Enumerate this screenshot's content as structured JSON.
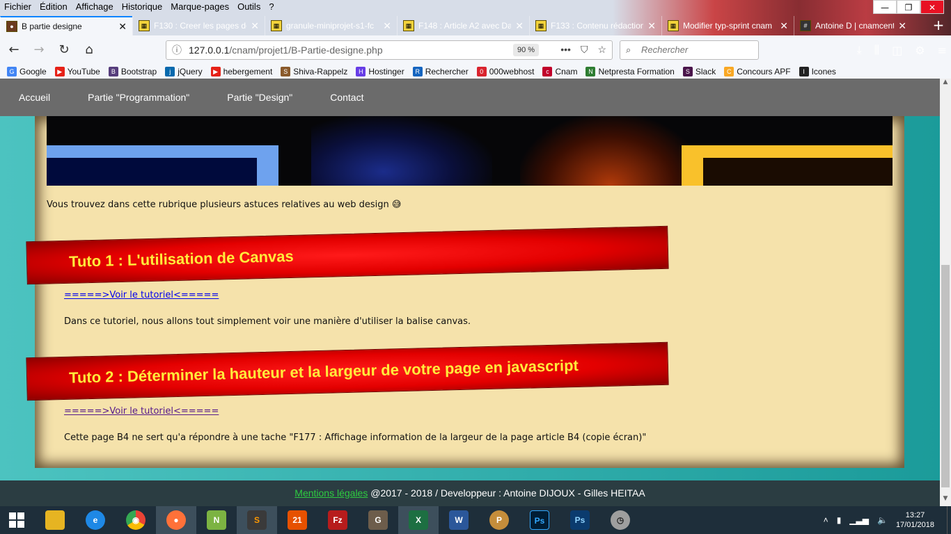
{
  "browser": {
    "menu": [
      "Fichier",
      "Édition",
      "Affichage",
      "Historique",
      "Marque-pages",
      "Outils",
      "?"
    ],
    "window_controls": {
      "minimize": "—",
      "maximize": "❐",
      "close": "✕"
    },
    "tabs": [
      {
        "title": "B partie designe",
        "active": true
      },
      {
        "title": "F130 : Creer les pages de",
        "active": false
      },
      {
        "title": "granule-miniprojet-s1-fc",
        "active": false
      },
      {
        "title": "F148 : Article A2 avec Da",
        "active": false
      },
      {
        "title": "F133 : Contenu rédaction",
        "active": false
      },
      {
        "title": "Modifier typ-sprint cnam",
        "active": false
      },
      {
        "title": "Antoine D | cnamcentre",
        "active": false
      }
    ],
    "new_tab": "+",
    "url": {
      "host": "127.0.0.1",
      "path": "/cnam/projet1/B-Partie-designe.php"
    },
    "zoom": "90 %",
    "search_placeholder": "Rechercher",
    "bookmarks": [
      {
        "label": "Google",
        "color": "#4285f4",
        "glyph": "G"
      },
      {
        "label": "YouTube",
        "color": "#e62117",
        "glyph": "▶"
      },
      {
        "label": "Bootstrap",
        "color": "#563d7c",
        "glyph": "B"
      },
      {
        "label": "jQuery",
        "color": "#0769ad",
        "glyph": "j"
      },
      {
        "label": "hebergement",
        "color": "#e62117",
        "glyph": "▶"
      },
      {
        "label": "Shiva-Rappelz",
        "color": "#8a5a2b",
        "glyph": "S"
      },
      {
        "label": "Hostinger",
        "color": "#673de6",
        "glyph": "H"
      },
      {
        "label": "Rechercher",
        "color": "#1565c0",
        "glyph": "R"
      },
      {
        "label": "000webhost",
        "color": "#d9232e",
        "glyph": "0"
      },
      {
        "label": "Cnam",
        "color": "#c1002a",
        "glyph": "c"
      },
      {
        "label": "Netpresta Formation",
        "color": "#2e7d32",
        "glyph": "N"
      },
      {
        "label": "Slack",
        "color": "#4a154b",
        "glyph": "S"
      },
      {
        "label": "Concours APF",
        "color": "#f9a825",
        "glyph": "C"
      },
      {
        "label": "Icones",
        "color": "#222222",
        "glyph": "I"
      }
    ]
  },
  "site": {
    "nav": [
      "Accueil",
      "Partie \"Programmation\"",
      "Partie \"Design\"",
      "Contact"
    ],
    "intro": "Vous trouvez dans cette rubrique plusieurs astuces relatives au web design 😅",
    "tutorials": [
      {
        "title": "Tuto 1 : L'utilisation de Canvas",
        "link": "=====>Voir le tutoriel<=====",
        "link_color": "#0000ee",
        "desc": "Dans ce tutoriel, nous allons tout simplement voir une manière d'utiliser la balise canvas."
      },
      {
        "title": "Tuto 2 : Déterminer la hauteur et la largeur de votre page en javascript",
        "link": "=====>Voir le tutoriel<=====",
        "link_color": "#551a8b",
        "desc": "Cette page B4 ne sert qu'a répondre à une tache \"F177 : Affichage information de la largeur de la page article B4 (copie écran)\""
      }
    ],
    "footer": {
      "link": "Mentions légales",
      "text": " @2017 - 2018 / Developpeur : Antoine DIJOUX - Gilles HEITAA"
    }
  },
  "taskbar": {
    "apps": [
      {
        "name": "file-explorer",
        "label": "",
        "color": "#e6b422"
      },
      {
        "name": "internet-explorer",
        "label": "e",
        "color": "#1e88e5"
      },
      {
        "name": "chrome",
        "label": "◉",
        "color": "#34a853"
      },
      {
        "name": "firefox",
        "label": "●",
        "color": "#ff7139",
        "active": true
      },
      {
        "name": "notepad-plus",
        "label": "N",
        "color": "#7cb342"
      },
      {
        "name": "sublime-text",
        "label": "S",
        "color": "#ff9800"
      },
      {
        "name": "app-21",
        "label": "21",
        "color": "#e65100"
      },
      {
        "name": "filezilla",
        "label": "Fz",
        "color": "#b71c1c"
      },
      {
        "name": "gimp",
        "label": "G",
        "color": "#6d5d4b"
      },
      {
        "name": "excel",
        "label": "X",
        "color": "#1d6f42",
        "active": true
      },
      {
        "name": "word",
        "label": "W",
        "color": "#2b579a"
      },
      {
        "name": "paint",
        "label": "P",
        "color": "#c48d3b"
      },
      {
        "name": "photoshop",
        "label": "Ps",
        "color": "#001d34"
      },
      {
        "name": "photoshop-2",
        "label": "Ps",
        "color": "#0b3b6e"
      },
      {
        "name": "clock-app",
        "label": "◷",
        "color": "#9e9e9e"
      }
    ],
    "time": "13:27",
    "date": "17/01/2018"
  }
}
